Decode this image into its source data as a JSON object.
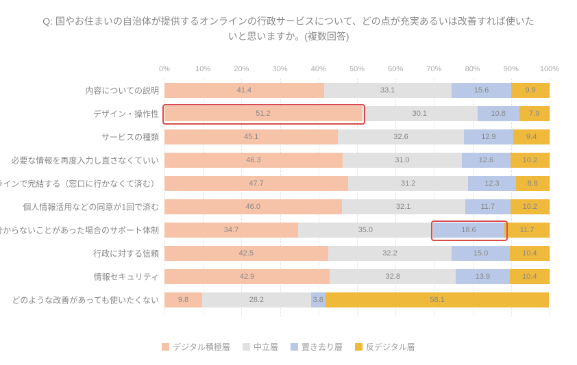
{
  "chart_data": {
    "type": "bar",
    "orientation": "horizontal-stacked-100",
    "title_prefix": "Q: ",
    "title": "国やお住まいの自治体が提供するオンラインの行政サービスについて、どの点が充実あるいは改善すれば使いたいと思いますか。(複数回答)",
    "xlabel": "",
    "ylabel": "",
    "xticks": [
      "0%",
      "10%",
      "20%",
      "30%",
      "40%",
      "50%",
      "60%",
      "70%",
      "80%",
      "90%",
      "100%"
    ],
    "xlim": [
      0,
      100
    ],
    "categories": [
      "内容についての説明",
      "デザイン・操作性",
      "サービスの種類",
      "必要な情報を再度入力し直さなくていい",
      "オンラインで完結する（窓口に行かなくて済む）",
      "個人情報活用などの同意が1回で済む",
      "分からないことがあった場合のサポート体制",
      "行政に対する信頼",
      "情報セキュリティ",
      "どのような改善があっても使いたくない"
    ],
    "series": [
      {
        "name": "デジタル積極層",
        "color": "#f6c3a8",
        "values": [
          41.4,
          51.2,
          45.1,
          46.3,
          47.7,
          46.0,
          34.7,
          42.5,
          42.9,
          9.8
        ]
      },
      {
        "name": "中立層",
        "color": "#e1e1e1",
        "values": [
          33.1,
          30.1,
          32.6,
          31.0,
          31.2,
          32.1,
          35.0,
          32.2,
          32.8,
          28.2
        ]
      },
      {
        "name": "置き去り層",
        "color": "#b9c8e6",
        "values": [
          15.6,
          10.8,
          12.9,
          12.6,
          12.3,
          11.7,
          18.6,
          15.0,
          13.9,
          3.8
        ]
      },
      {
        "name": "反デジタル層",
        "color": "#efb93c",
        "values": [
          9.9,
          7.9,
          9.4,
          10.2,
          8.8,
          10.2,
          11.7,
          10.4,
          10.4,
          58.1
        ]
      }
    ],
    "highlights": [
      {
        "row": 1,
        "segments": [
          0
        ]
      },
      {
        "row": 6,
        "segments": [
          2
        ]
      }
    ]
  }
}
